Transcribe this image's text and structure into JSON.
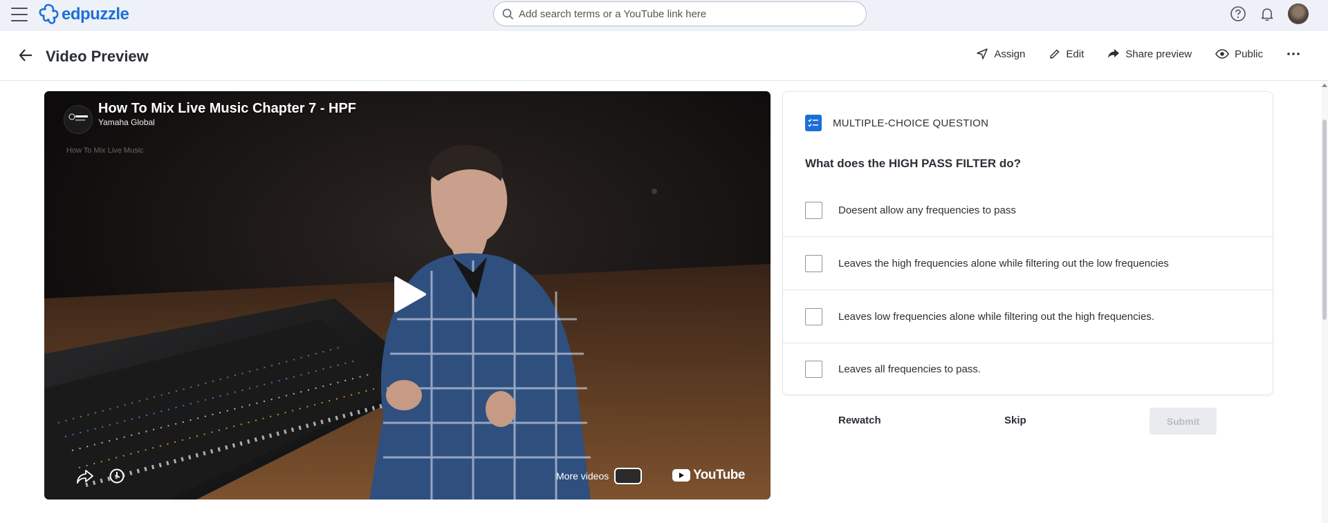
{
  "topbar": {
    "logo_text": "edpuzzle",
    "search": {
      "placeholder": "Add search terms or a YouTube link here",
      "value": ""
    },
    "icons": [
      "menu-icon",
      "search-icon",
      "help-icon",
      "bell-icon",
      "avatar"
    ]
  },
  "header": {
    "title": "Video Preview",
    "actions": {
      "assign": "Assign",
      "edit": "Edit",
      "share_preview": "Share preview",
      "public": "Public"
    }
  },
  "video": {
    "title": "How To Mix Live Music Chapter 7 - HPF",
    "channel": "Yamaha Global",
    "watermark": "How To Mix Live Music",
    "more_videos": "More videos",
    "youtube_label": "YouTube"
  },
  "question": {
    "type_label": "MULTIPLE-CHOICE QUESTION",
    "text": "What does the HIGH PASS FILTER do?",
    "options": [
      {
        "label": "Doesent allow any frequencies to pass",
        "checked": false
      },
      {
        "label": "Leaves the high frequencies alone while filtering out the low frequencies",
        "checked": false
      },
      {
        "label": "Leaves low frequencies alone while filtering out the high frequencies.",
        "checked": false
      },
      {
        "label": "Leaves all frequencies to pass.",
        "checked": false
      }
    ],
    "rewatch_label": "Rewatch",
    "skip_label": "Skip",
    "submit_label": "Submit"
  },
  "colors": {
    "brand": "#1d6fd8",
    "topbar_bg": "#eef1f8",
    "submit_disabled_bg": "#e9ebef"
  }
}
